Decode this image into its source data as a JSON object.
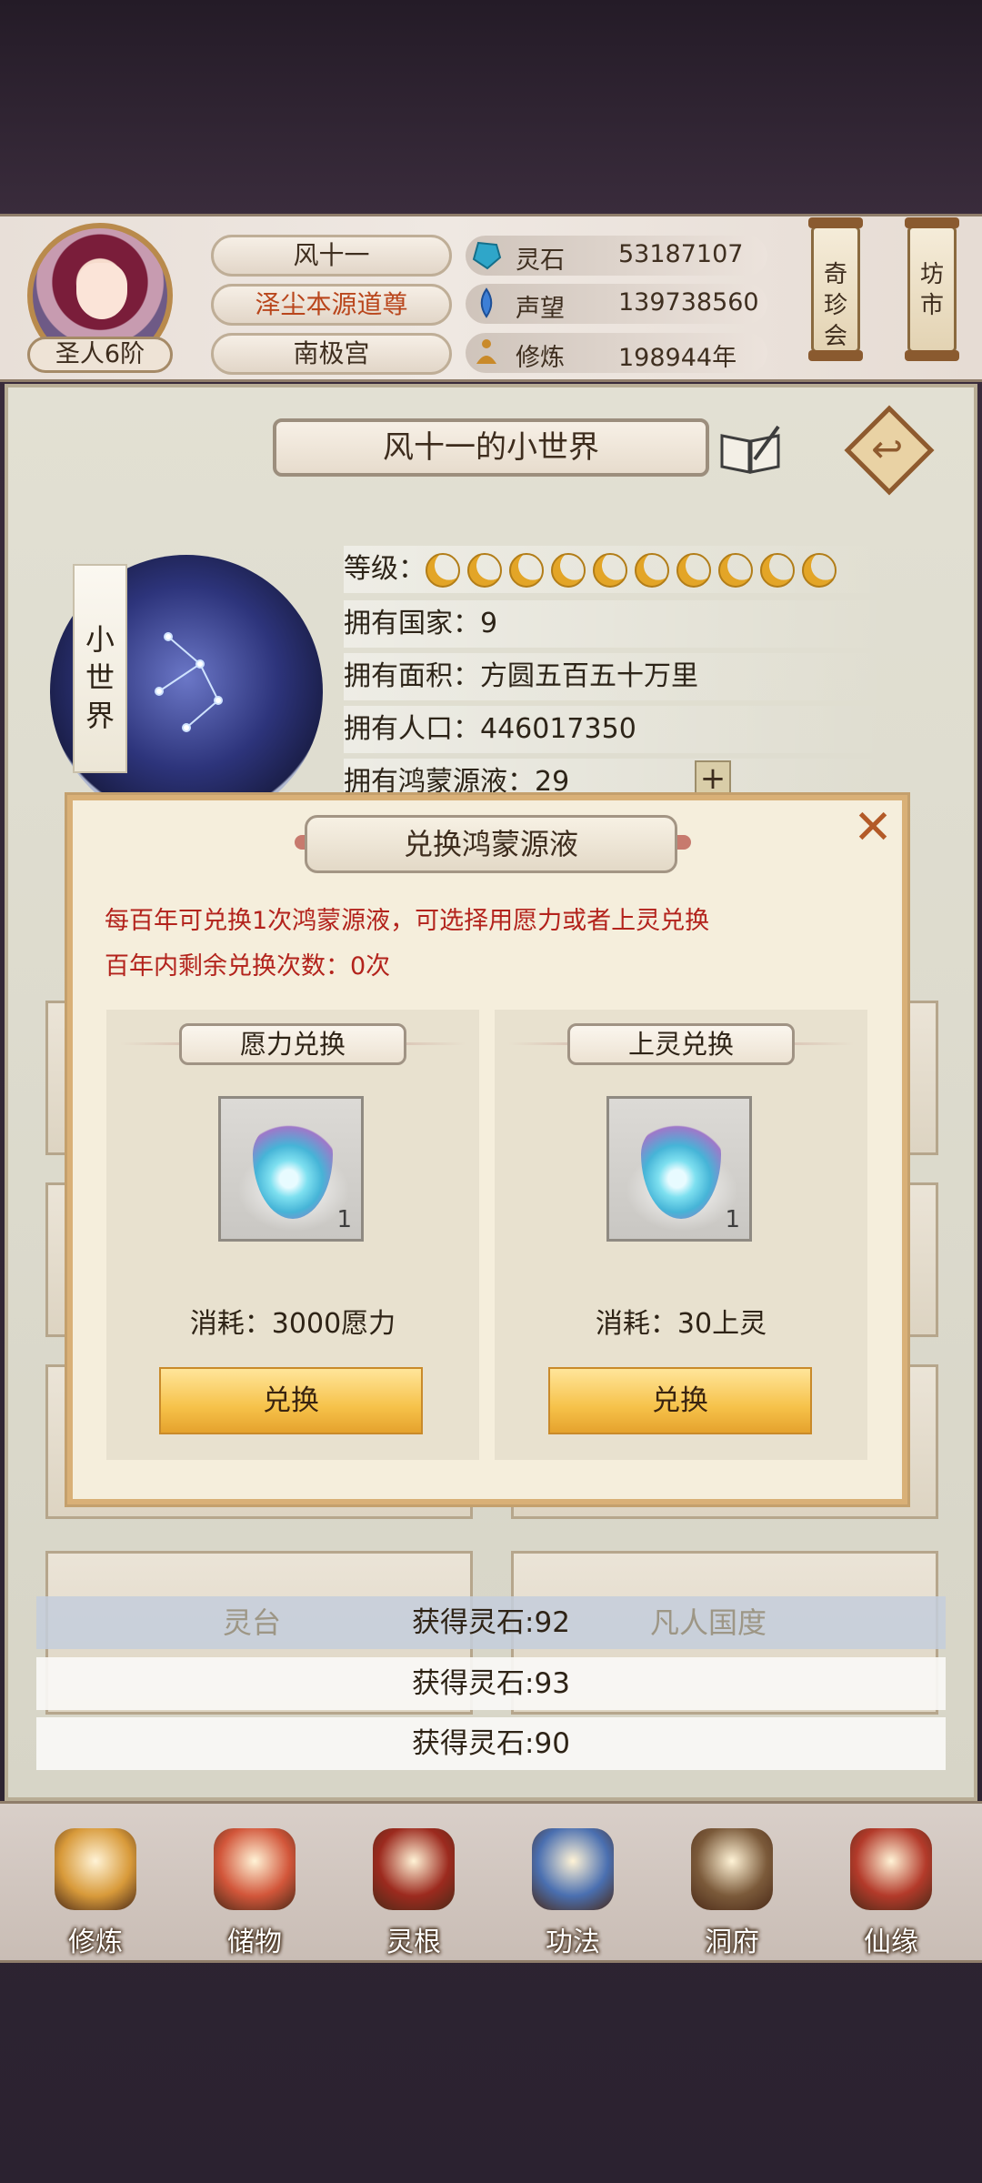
{
  "player": {
    "name": "风十一",
    "title": "泽尘本源道尊",
    "sect": "南极宫",
    "rank": "圣人6阶"
  },
  "resources": [
    {
      "label": "灵石",
      "value": "53187107",
      "icon": "spirit-stone-icon"
    },
    {
      "label": "声望",
      "value": "139738560",
      "icon": "reputation-icon"
    },
    {
      "label": "修炼",
      "value": "198944年",
      "icon": "meditation-icon"
    }
  ],
  "side_buttons": {
    "treasure": "奇珍会",
    "market": "坊市"
  },
  "world": {
    "title": "风十一的小世界",
    "tag": "小世界",
    "level_label": "等级：",
    "level_count": 10,
    "countries": "拥有国家：9",
    "area": "拥有面积：方圆五百五十万里",
    "population": "拥有人口：446017350",
    "liquid": "拥有鸿蒙源液：29",
    "plus": "+"
  },
  "modal": {
    "title": "兑换鸿蒙源液",
    "close": "✕",
    "notice1": "每百年可兑换1次鸿蒙源液，可选择用愿力或者上灵兑换",
    "notice2": "百年内剩余兑换次数：0次",
    "options": [
      {
        "header": "愿力兑换",
        "count": "1",
        "cost": "消耗：3000愿力",
        "button": "兑换"
      },
      {
        "header": "上灵兑换",
        "count": "1",
        "cost": "消耗：30上灵",
        "button": "兑换"
      }
    ]
  },
  "behind": {
    "left": "灵台",
    "right": "凡人国度"
  },
  "toasts": [
    "获得灵石:92",
    "获得灵石:93",
    "获得灵石:90"
  ],
  "nav": [
    {
      "label": "修炼",
      "icon": "cultivation-icon",
      "color": "#d89a3a"
    },
    {
      "label": "储物",
      "icon": "storage-bag-icon",
      "color": "#d2563a"
    },
    {
      "label": "灵根",
      "icon": "spirit-root-icon",
      "color": "#9c2a1e"
    },
    {
      "label": "功法",
      "icon": "technique-book-icon",
      "color": "#4a6fb0"
    },
    {
      "label": "洞府",
      "icon": "cave-dwelling-icon",
      "color": "#7b5a3a"
    },
    {
      "label": "仙缘",
      "icon": "gourd-icon",
      "color": "#b33a2a"
    }
  ]
}
